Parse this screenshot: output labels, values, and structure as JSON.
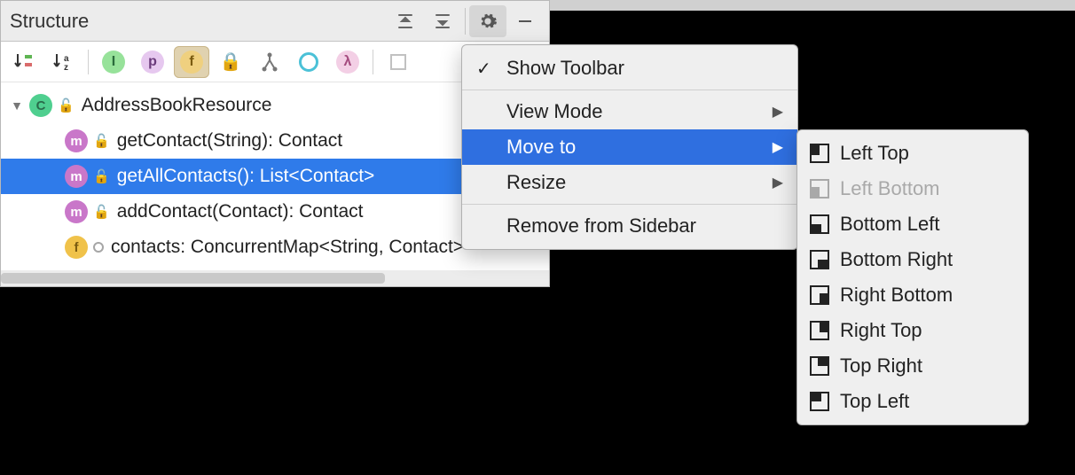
{
  "panel": {
    "title": "Structure"
  },
  "tree": {
    "root": {
      "label": "AddressBookResource",
      "children": [
        {
          "label": "getContact(String): Contact"
        },
        {
          "label": "getAllContacts(): List<Contact>"
        },
        {
          "label": "addContact(Contact): Contact"
        },
        {
          "label": "contacts: ConcurrentMap<String, Contact>"
        }
      ]
    }
  },
  "menu": {
    "show_toolbar": "Show Toolbar",
    "view_mode": "View Mode",
    "move_to": "Move to",
    "resize": "Resize",
    "remove": "Remove from Sidebar"
  },
  "submenu": {
    "left_top": "Left Top",
    "left_bottom": "Left Bottom",
    "bottom_left": "Bottom Left",
    "bottom_right": "Bottom Right",
    "right_bottom": "Right Bottom",
    "right_top": "Right Top",
    "top_right": "Top Right",
    "top_left": "Top Left"
  }
}
